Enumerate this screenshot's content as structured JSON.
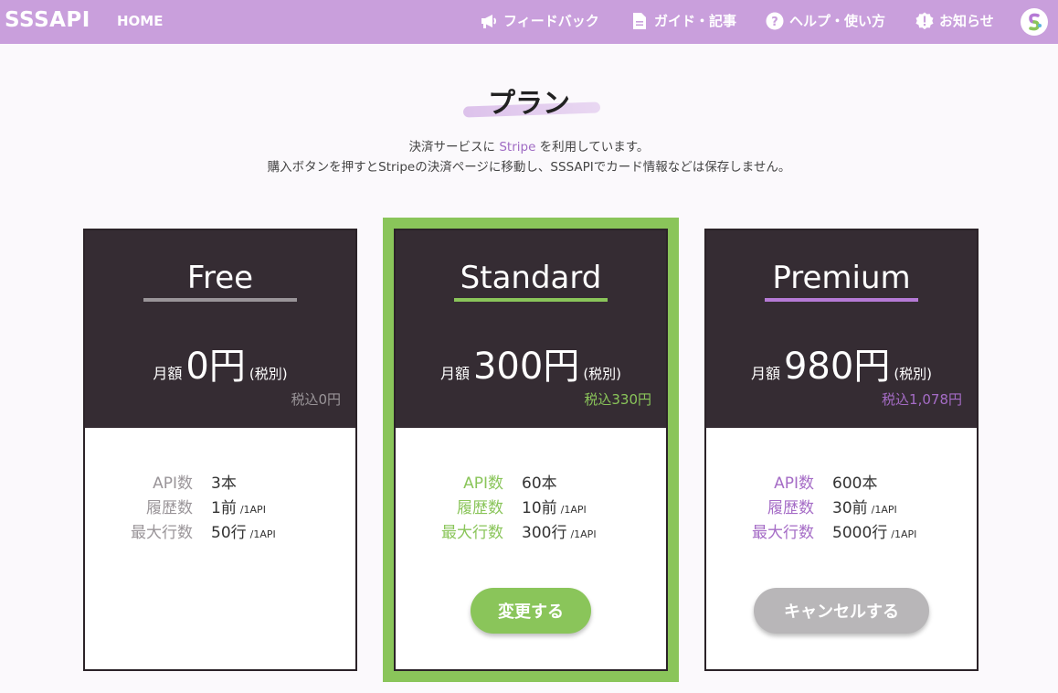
{
  "header": {
    "logo": "SSSAPI",
    "home": "HOME",
    "nav": {
      "feedback": "フィードバック",
      "guide": "ガイド・記事",
      "help": "ヘルプ・使い方",
      "news": "お知らせ"
    }
  },
  "page": {
    "title": "プラン",
    "sub1_pre": "決済サービスに ",
    "sub1_link": "Stripe",
    "sub1_post": " を利用しています。",
    "sub2": "購入ボタンを押すとStripeの決済ページに移動し、SSSAPIでカード情報などは保存しません。"
  },
  "plans": [
    {
      "name": "Free",
      "monthly": "月額",
      "amount": "0円",
      "tax_note": "(税別)",
      "tax_in": "税込0円",
      "features": [
        {
          "label": "API数",
          "value": "3本",
          "per": ""
        },
        {
          "label": "履歴数",
          "value": "1前",
          "per": "/1API"
        },
        {
          "label": "最大行数",
          "value": "50行",
          "per": "/1API"
        }
      ]
    },
    {
      "name": "Standard",
      "monthly": "月額",
      "amount": "300円",
      "tax_note": "(税別)",
      "tax_in": "税込330円",
      "features": [
        {
          "label": "API数",
          "value": "60本",
          "per": ""
        },
        {
          "label": "履歴数",
          "value": "10前",
          "per": "/1API"
        },
        {
          "label": "最大行数",
          "value": "300行",
          "per": "/1API"
        }
      ],
      "button": "変更する"
    },
    {
      "name": "Premium",
      "monthly": "月額",
      "amount": "980円",
      "tax_note": "(税別)",
      "tax_in": "税込1,078円",
      "features": [
        {
          "label": "API数",
          "value": "600本",
          "per": ""
        },
        {
          "label": "履歴数",
          "value": "30前",
          "per": "/1API"
        },
        {
          "label": "最大行数",
          "value": "5000行",
          "per": "/1API"
        }
      ],
      "button": "キャンセルする"
    }
  ],
  "colors": {
    "header": "#c99fdc",
    "free_accent": "#9a9599",
    "standard_accent": "#8ac55a",
    "premium_accent": "#b57ad6",
    "card_head": "#352c33"
  }
}
